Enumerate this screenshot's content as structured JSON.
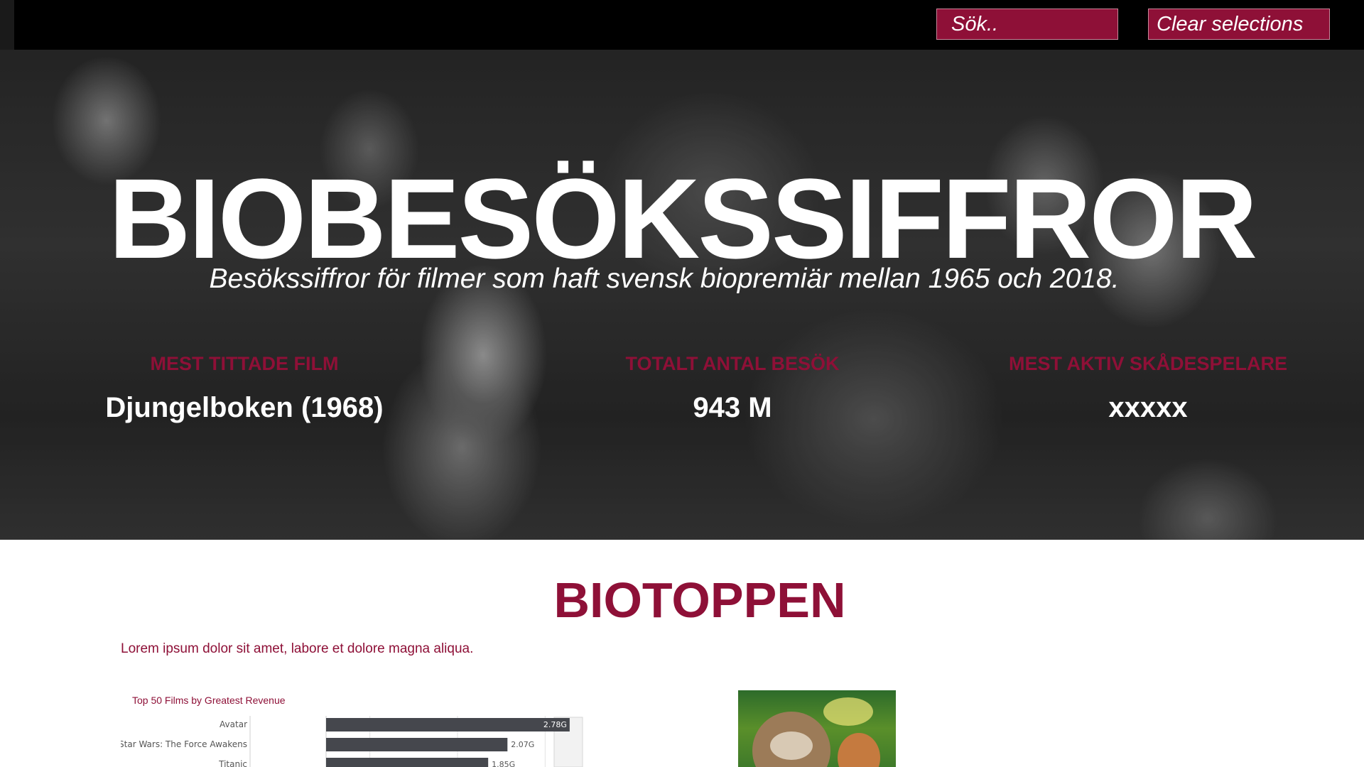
{
  "toolbar": {
    "search_label": "Sök..",
    "clear_label": "Clear selections"
  },
  "hero": {
    "title": "BIOBESÖKSSIFFROR",
    "subtitle": "Besökssiffror för filmer som haft svensk biopremiär mellan 1965 och 2018."
  },
  "kpis": [
    {
      "label": "MEST TITTADE FILM",
      "value": "Djungelboken (1968)"
    },
    {
      "label": "TOTALT ANTAL BESÖK",
      "value": "943 M"
    },
    {
      "label": "MEST AKTIV SKÅDESPELARE",
      "value": "xxxxx"
    }
  ],
  "section": {
    "title": "BIOTOPPEN",
    "intro": "Lorem ipsum dolor sit amet,  labore et dolore magna aliqua."
  },
  "chart_data": {
    "type": "bar",
    "orientation": "horizontal",
    "title": "Top 50 Films by Greatest Revenue",
    "categories": [
      "Avatar",
      "Star Wars: The Force Awakens",
      "Titanic"
    ],
    "values": [
      2.78,
      2.07,
      1.85
    ],
    "value_labels": [
      "2.78G",
      "2.07G",
      "1.85G"
    ],
    "xlim": [
      0,
      3
    ],
    "xlabel": "",
    "ylabel": "",
    "bar_color": "#45474d",
    "grid": true
  },
  "colors": {
    "accent": "#8e1037",
    "topbar": "#000000",
    "bar": "#45474d"
  }
}
